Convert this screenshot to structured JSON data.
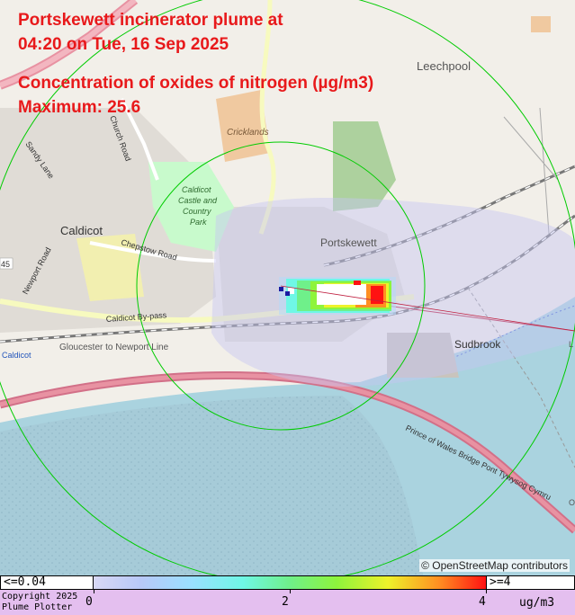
{
  "title": {
    "line1": "Portskewett incinerator plume at",
    "line2": "04:20 on Tue, 16 Sep 2025",
    "line3": "Concentration of oxides of nitrogen (µg/m3)",
    "line4": "Maximum: 25.6"
  },
  "attribution": "© OpenStreetMap contributors",
  "map_labels": {
    "leechpool": "Leechpool",
    "cricklands": "Cricklands",
    "caldicot": "Caldicot",
    "caldicot_castle": "Caldicot",
    "caldicot_castle2": "Castle and",
    "caldicot_castle3": "Country",
    "caldicot_castle4": "Park",
    "portskewett": "Portskewett",
    "sudbrook": "Sudbrook",
    "chepstow_road": "Chepstow Road",
    "church_road": "Church Road",
    "sandy_lane": "Sandy Lane",
    "newport_road": "Newport Road",
    "caldicot_bypass": "Caldicot By-pass",
    "gloucester_line": "Gloucester to Newport Line",
    "bridge": "Prince of Wales Bridge  Pont Tywysog Cymru",
    "road_shield": "45",
    "station": "Caldicot",
    "edge_l": "L",
    "edge_o": "O"
  },
  "legend": {
    "low": "<=0.04",
    "high": ">=4",
    "ticks": [
      "0",
      "2",
      "4"
    ],
    "unit": "ug/m3",
    "copyright_line1": "Copyright 2025",
    "copyright_line2": "Plume Plotter"
  },
  "colors": {
    "title": "#e8191b",
    "water": "#aad3df",
    "land": "#f2efe9",
    "wood": "#add19e",
    "park": "#c8facc",
    "rings": "#00cc00",
    "legend_bg": "#e4bfef"
  }
}
